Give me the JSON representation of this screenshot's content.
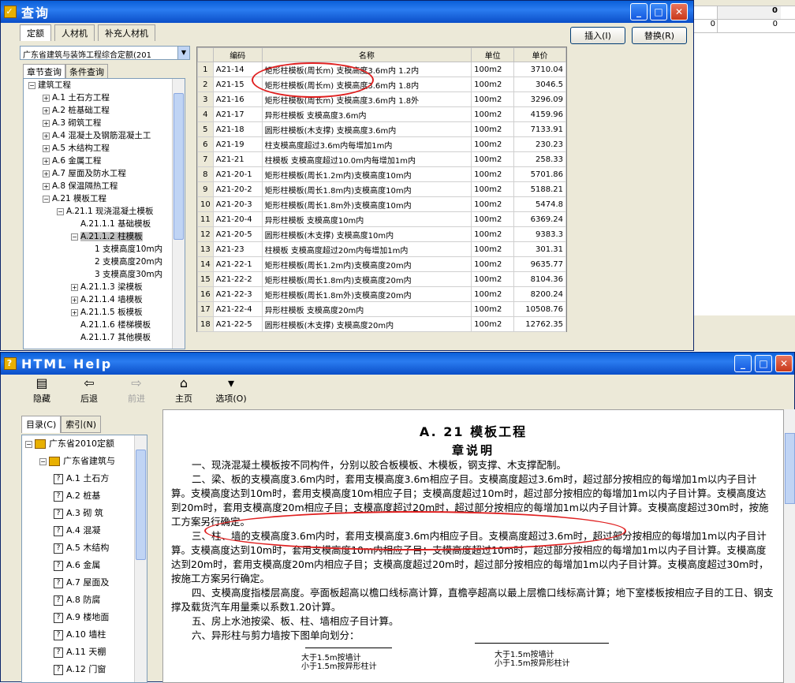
{
  "query": {
    "title": "查询",
    "tabs": [
      "定额",
      "人材机",
      "补充人材机"
    ],
    "insert_label": "插入(I)",
    "replace_label": "替换(R)",
    "quota_select": "广东省建筑与装饰工程综合定额(201",
    "subtabs": [
      "章节查询",
      "条件查询"
    ],
    "tree": [
      {
        "t": "建筑工程",
        "lvl": 0,
        "exp": "−"
      },
      {
        "t": "A.1 土石方工程",
        "lvl": 1,
        "exp": "+"
      },
      {
        "t": "A.2 桩基础工程",
        "lvl": 1,
        "exp": "+"
      },
      {
        "t": "A.3 砌筑工程",
        "lvl": 1,
        "exp": "+"
      },
      {
        "t": "A.4 混凝土及钢筋混凝土工",
        "lvl": 1,
        "exp": "+"
      },
      {
        "t": "A.5 木结构工程",
        "lvl": 1,
        "exp": "+"
      },
      {
        "t": "A.6 金属工程",
        "lvl": 1,
        "exp": "+"
      },
      {
        "t": "A.7 屋面及防水工程",
        "lvl": 1,
        "exp": "+"
      },
      {
        "t": "A.8 保温隔热工程",
        "lvl": 1,
        "exp": "+"
      },
      {
        "t": "A.21 模板工程",
        "lvl": 1,
        "exp": "−"
      },
      {
        "t": "A.21.1 现浇混凝土模板",
        "lvl": 2,
        "exp": "−"
      },
      {
        "t": "A.21.1.1 基础模板",
        "lvl": 3,
        "exp": ""
      },
      {
        "t": "A.21.1.2 柱模板",
        "lvl": 3,
        "exp": "−",
        "sel": true
      },
      {
        "t": "1 支模高度10m内",
        "lvl": 4,
        "exp": ""
      },
      {
        "t": "2 支模高度20m内",
        "lvl": 4,
        "exp": ""
      },
      {
        "t": "3 支模高度30m内",
        "lvl": 4,
        "exp": ""
      },
      {
        "t": "A.21.1.3 梁模板",
        "lvl": 3,
        "exp": "+"
      },
      {
        "t": "A.21.1.4 墙模板",
        "lvl": 3,
        "exp": "+"
      },
      {
        "t": "A.21.1.5 板模板",
        "lvl": 3,
        "exp": "+"
      },
      {
        "t": "A.21.1.6 楼梯模板",
        "lvl": 3,
        "exp": ""
      },
      {
        "t": "A.21.1.7 其他模板",
        "lvl": 3,
        "exp": ""
      }
    ],
    "headers": [
      "编码",
      "名称",
      "单位",
      "单价"
    ],
    "rows": [
      [
        "1",
        "A21-14",
        "矩形柱模板(周长m) 支模高度3.6m内 1.2内",
        "100m2",
        "3710.04"
      ],
      [
        "2",
        "A21-15",
        "矩形柱模板(周长m) 支模高度3.6m内 1.8内",
        "100m2",
        "3046.5"
      ],
      [
        "3",
        "A21-16",
        "矩形柱模板(周长m) 支模高度3.6m内 1.8外",
        "100m2",
        "3296.09"
      ],
      [
        "4",
        "A21-17",
        "异形柱模板 支模高度3.6m内",
        "100m2",
        "4159.96"
      ],
      [
        "5",
        "A21-18",
        "圆形柱模板(木支撑) 支模高度3.6m内",
        "100m2",
        "7133.91"
      ],
      [
        "6",
        "A21-19",
        "柱支模高度超过3.6m内每增加1m内",
        "100m2",
        "230.23"
      ],
      [
        "7",
        "A21-21",
        "柱模板 支模高度超过10.0m内每增加1m内",
        "100m2",
        "258.33"
      ],
      [
        "8",
        "A21-20-1",
        "矩形柱模板(周长1.2m内)支模高度10m内",
        "100m2",
        "5701.86"
      ],
      [
        "9",
        "A21-20-2",
        "矩形柱模板(周长1.8m内)支模高度10m内",
        "100m2",
        "5188.21"
      ],
      [
        "10",
        "A21-20-3",
        "矩形柱模板(周长1.8m外)支模高度10m内",
        "100m2",
        "5474.8"
      ],
      [
        "11",
        "A21-20-4",
        "异形柱模板 支模高度10m内",
        "100m2",
        "6369.24"
      ],
      [
        "12",
        "A21-20-5",
        "圆形柱模板(木支撑) 支模高度10m内",
        "100m2",
        "9383.3"
      ],
      [
        "13",
        "A21-23",
        "柱模板 支模高度超过20m内每增加1m内",
        "100m2",
        "301.31"
      ],
      [
        "14",
        "A21-22-1",
        "矩形柱模板(周长1.2m内)支模高度20m内",
        "100m2",
        "9635.77"
      ],
      [
        "15",
        "A21-22-2",
        "矩形柱模板(周长1.8m内)支模高度20m内",
        "100m2",
        "8104.36"
      ],
      [
        "16",
        "A21-22-3",
        "矩形柱模板(周长1.8m外)支模高度20m内",
        "100m2",
        "8200.24"
      ],
      [
        "17",
        "A21-22-4",
        "异形柱模板 支模高度20m内",
        "100m2",
        "10508.76"
      ],
      [
        "18",
        "A21-22-5",
        "圆形柱模板(木支撑) 支模高度20m内",
        "100m2",
        "12762.35"
      ]
    ]
  },
  "right_panel": {
    "v1": "0",
    "v2": "0",
    "v3": "0"
  },
  "help": {
    "title": "HTML Help",
    "tools": [
      {
        "label": "隐藏",
        "icon": "▤",
        "dis": false
      },
      {
        "label": "后退",
        "icon": "⇦",
        "dis": false
      },
      {
        "label": "前进",
        "icon": "⇨",
        "dis": true
      },
      {
        "label": "主页",
        "icon": "⌂",
        "dis": false
      },
      {
        "label": "选项(O)",
        "icon": "▾",
        "dis": false
      }
    ],
    "navtabs": [
      "目录(C)",
      "索引(N)"
    ],
    "nav": [
      {
        "t": "广东省2010定额",
        "lvl": 0,
        "kind": "book"
      },
      {
        "t": "广东省建筑与",
        "lvl": 1,
        "kind": "book"
      },
      {
        "t": "A.1 土石方",
        "lvl": 2,
        "kind": "q"
      },
      {
        "t": "A.2 桩基",
        "lvl": 2,
        "kind": "q"
      },
      {
        "t": "A.3 砌 筑",
        "lvl": 2,
        "kind": "q"
      },
      {
        "t": "A.4 混凝",
        "lvl": 2,
        "kind": "q"
      },
      {
        "t": "A.5 木结构",
        "lvl": 2,
        "kind": "q"
      },
      {
        "t": "A.6 金属",
        "lvl": 2,
        "kind": "q"
      },
      {
        "t": "A.7 屋面及",
        "lvl": 2,
        "kind": "q"
      },
      {
        "t": "A.8 防腐",
        "lvl": 2,
        "kind": "q"
      },
      {
        "t": "A.9 楼地面",
        "lvl": 2,
        "kind": "q"
      },
      {
        "t": "A.10 墙柱",
        "lvl": 2,
        "kind": "q"
      },
      {
        "t": "A.11 天棚",
        "lvl": 2,
        "kind": "q"
      },
      {
        "t": "A.12 门窗",
        "lvl": 2,
        "kind": "q"
      }
    ],
    "heading": "A. 21 模板工程",
    "subheading": "章说明",
    "paras": [
      "一、现浇混凝土模板按不同构件，分别以胶合板模板、木模板，钢支撑、木支撑配制。",
      "二、梁、板的支模高度3.6m内时，套用支模高度3.6m相应子目。支模高度超过3.6m时，超过部分按相应的每增加1m以内子目计算。支模高度达到10m时，套用支模高度10m相应子目；支模高度超过10m时，超过部分按相应的每增加1m以内子目计算。支模高度达到20m时，套用支模高度20m相应子目；支模高度超过20m时，超过部分按相应的每增加1m以内子目计算。支模高度超过30m时，按施工方案另行确定。",
      "三、柱、墙的支模高度3.6m内时，套用支模高度3.6m内相应子目。支模高度超过3.6m时，超过部分按相应的每增加1m以内子目计算。支模高度达到10m时，套用支模高度10m内相应子目；支模高度超过10m时，超过部分按相应的每增加1m以内子目计算。支模高度达到20m时，套用支模高度20m内相应子目；支模高度超过20m时，超过部分按相应的每增加1m以内子目计算。支模高度超过30m时，按施工方案另行确定。",
      "四、支模高度指楼层高度。亭面板超高以檐口线标高计算，直檐亭超高以最上层檐口线标高计算；地下室楼板按相应子目的工日、钢支撑及载货汽车用量乘以系数1.20计算。",
      "五、房上水池按梁、板、柱、墙相应子目计算。",
      "六、异形柱与剪力墙按下图单向划分："
    ],
    "fig_labels": [
      "大于1.5m按墙计",
      "小于1.5m按异形柱计",
      "大于1.5m按墙计",
      "小于1.5m按异形柱计"
    ]
  }
}
